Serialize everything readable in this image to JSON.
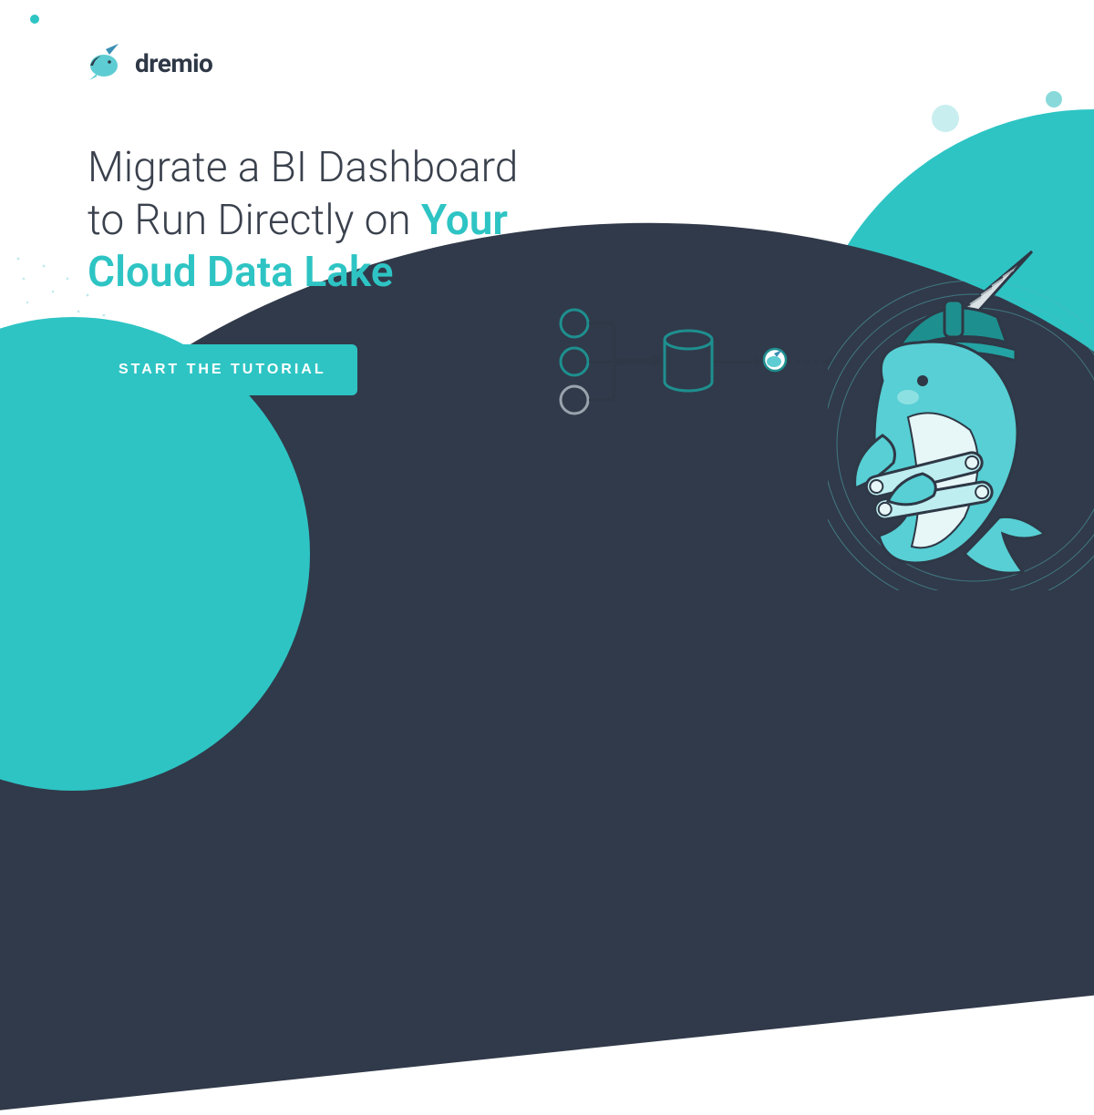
{
  "brand": {
    "name": "dremio"
  },
  "headline": {
    "plain_1": "Migrate a BI Dashboard",
    "plain_2": "to Run Directly on ",
    "em_1": "Your",
    "em_2": "Cloud Data Lake"
  },
  "cta": {
    "label": "START THE TUTORIAL"
  },
  "colors": {
    "teal": "#2ec4c4",
    "navy": "#313a4a",
    "text": "#3a414d"
  }
}
